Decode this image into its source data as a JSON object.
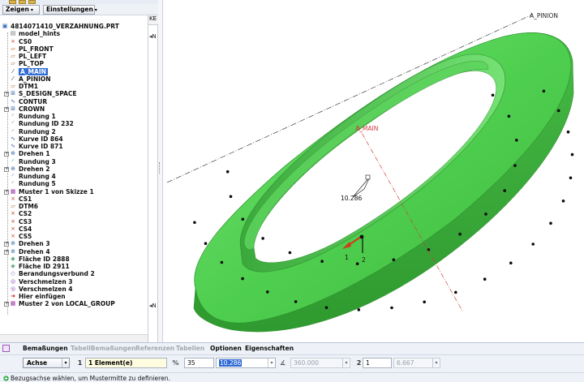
{
  "tree_toolbar": {
    "show_label": "Zeigen",
    "settings_label": "Einstellungen"
  },
  "tree_column_header": "KE",
  "model_tree": [
    {
      "label": "4814071410_VERZAHNUNG.PRT",
      "icon": "part-icon",
      "indent": 0,
      "expandable": false
    },
    {
      "label": "model_hints",
      "icon": "layer-icon",
      "indent": 1,
      "expandable": false
    },
    {
      "label": "CS0",
      "icon": "coordinate-system-icon",
      "indent": 1,
      "expandable": false
    },
    {
      "label": "PL_FRONT",
      "icon": "datum-plane-icon",
      "indent": 1,
      "expandable": false
    },
    {
      "label": "PL_LEFT",
      "icon": "datum-plane-icon",
      "indent": 1,
      "expandable": false
    },
    {
      "label": "PL_TOP",
      "icon": "datum-plane-icon",
      "indent": 1,
      "expandable": false
    },
    {
      "label": "A_MAIN",
      "icon": "datum-axis-icon",
      "indent": 1,
      "expandable": false,
      "selected": true
    },
    {
      "label": "A_PINION",
      "icon": "datum-axis-icon",
      "indent": 1,
      "expandable": false
    },
    {
      "label": "DTM1",
      "icon": "datum-plane-icon",
      "indent": 1,
      "expandable": false
    },
    {
      "label": "S_DESIGN_SPACE",
      "icon": "feature-icon",
      "indent": 1,
      "expandable": true
    },
    {
      "label": "CONTUR",
      "icon": "sketch-icon",
      "indent": 1,
      "expandable": false
    },
    {
      "label": "CROWN",
      "icon": "feature-icon",
      "indent": 1,
      "expandable": true
    },
    {
      "label": "Rundung 1",
      "icon": "round-icon",
      "indent": 1,
      "expandable": false
    },
    {
      "label": "Rundung ID 232",
      "icon": "round-icon",
      "indent": 1,
      "expandable": false
    },
    {
      "label": "Rundung 2",
      "icon": "round-icon",
      "indent": 1,
      "expandable": false
    },
    {
      "label": "Kurve ID 864",
      "icon": "curve-icon",
      "indent": 1,
      "expandable": false
    },
    {
      "label": "Kurve ID 871",
      "icon": "curve-icon",
      "indent": 1,
      "expandable": false
    },
    {
      "label": "Drehen 1",
      "icon": "revolve-icon",
      "indent": 1,
      "expandable": true
    },
    {
      "label": "Rundung 3",
      "icon": "round-icon",
      "indent": 1,
      "expandable": false
    },
    {
      "label": "Drehen 2",
      "icon": "revolve-icon",
      "indent": 1,
      "expandable": true
    },
    {
      "label": "Rundung 4",
      "icon": "round-icon",
      "indent": 1,
      "expandable": false
    },
    {
      "label": "Rundung 5",
      "icon": "round-icon",
      "indent": 1,
      "expandable": false
    },
    {
      "label": "Muster 1 von Skizze 1",
      "icon": "pattern-icon",
      "indent": 1,
      "expandable": true
    },
    {
      "label": "CS1",
      "icon": "coordinate-system-icon",
      "indent": 1,
      "expandable": false
    },
    {
      "label": "DTM6",
      "icon": "datum-plane-icon",
      "indent": 1,
      "expandable": false
    },
    {
      "label": "CS2",
      "icon": "coordinate-system-icon",
      "indent": 1,
      "expandable": false
    },
    {
      "label": "CS3",
      "icon": "coordinate-system-icon",
      "indent": 1,
      "expandable": false
    },
    {
      "label": "CS4",
      "icon": "coordinate-system-icon",
      "indent": 1,
      "expandable": false
    },
    {
      "label": "CS5",
      "icon": "coordinate-system-icon",
      "indent": 1,
      "expandable": false
    },
    {
      "label": "Drehen 3",
      "icon": "revolve-icon",
      "indent": 1,
      "expandable": true
    },
    {
      "label": "Drehen 4",
      "icon": "revolve-icon",
      "indent": 1,
      "expandable": true
    },
    {
      "label": "Fläche ID 2888",
      "icon": "surface-icon",
      "indent": 1,
      "expandable": false
    },
    {
      "label": "Fläche ID 2911",
      "icon": "surface-icon",
      "indent": 1,
      "expandable": false
    },
    {
      "label": "Berandungsverbund 2",
      "icon": "boundary-blend-icon",
      "indent": 1,
      "expandable": false
    },
    {
      "label": "Verschmelzen 3",
      "icon": "merge-icon",
      "indent": 1,
      "expandable": false
    },
    {
      "label": "Verschmelzen 4",
      "icon": "merge-icon",
      "indent": 1,
      "expandable": false
    },
    {
      "label": "Hier einfügen",
      "icon": "insert-here-icon",
      "indent": 1,
      "expandable": false
    },
    {
      "label": "Muster 2 von LOCAL_GROUP",
      "icon": "pattern-icon",
      "indent": 1,
      "expandable": true
    }
  ],
  "viewport": {
    "axis_labels": {
      "pinion": "A_PINION",
      "main": "A_MAIN"
    },
    "dimension_value": "10.286",
    "direction_labels": [
      "1",
      "2"
    ],
    "colors": {
      "ring": "#5fd65f",
      "ring_dark": "#3aa83a",
      "axis_main": "#d04040",
      "datum": "#333333",
      "arrow": "#d23a1d"
    }
  },
  "dashboard": {
    "tabs": [
      {
        "label": "Bemaßungen",
        "enabled": true
      },
      {
        "label": "TabellBemaßungen",
        "enabled": false
      },
      {
        "label": "Referenzen",
        "enabled": false
      },
      {
        "label": "Tabellen",
        "enabled": false
      },
      {
        "label": "Optionen",
        "enabled": true
      },
      {
        "label": "Eigenschaften",
        "enabled": true
      }
    ],
    "pattern_type": "Achse",
    "first_index": "1",
    "reference": "1 Element(e)",
    "count": "35",
    "spacing": "10.286",
    "angle_range": "360.000",
    "second_index": "2",
    "second_count": "1",
    "second_spacing": "6.667",
    "status_message": "Bezugsachse wählen, um Mustermitte zu definieren."
  }
}
